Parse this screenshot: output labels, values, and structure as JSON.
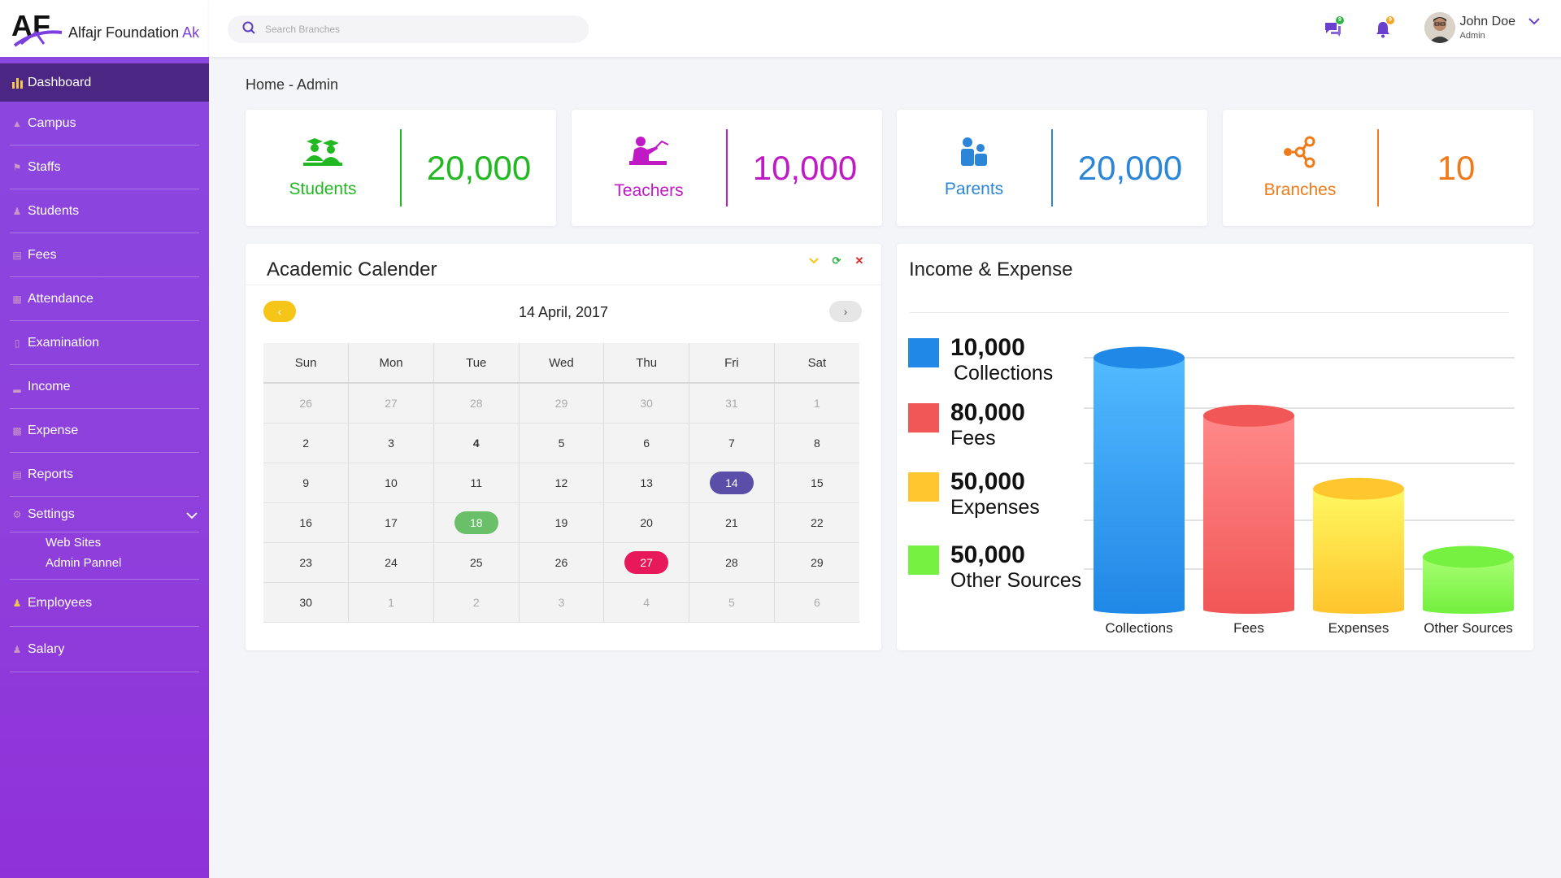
{
  "brand": {
    "logo_text": "AF",
    "name": "Alfajr Foundation",
    "name_accent": "Ak"
  },
  "search": {
    "placeholder": "Search Branches"
  },
  "topbar": {
    "chat_badge": "9",
    "notif_badge": "9"
  },
  "user": {
    "name": "John Doe",
    "role": "Admin"
  },
  "sidebar": {
    "items": [
      {
        "label": "Dashboard",
        "icon": "bar-chart-icon"
      },
      {
        "label": "Campus",
        "icon": "campus-icon"
      },
      {
        "label": "Staffs",
        "icon": "staff-icon"
      },
      {
        "label": "Students",
        "icon": "students-icon"
      },
      {
        "label": "Fees",
        "icon": "fees-icon"
      },
      {
        "label": "Attendance",
        "icon": "attendance-icon"
      },
      {
        "label": "Examination",
        "icon": "examination-icon"
      },
      {
        "label": "Income",
        "icon": "income-icon"
      },
      {
        "label": "Expense",
        "icon": "expense-icon"
      },
      {
        "label": "Reports",
        "icon": "reports-icon"
      },
      {
        "label": "Settings",
        "icon": "settings-icon"
      },
      {
        "label": "Employees",
        "icon": "employees-icon"
      },
      {
        "label": "Salary",
        "icon": "salary-icon"
      }
    ],
    "settings_sub": [
      "Web Sites",
      "Admin Pannel"
    ]
  },
  "breadcrumb": "Home - Admin",
  "stats": [
    {
      "label": "Students",
      "value": "20,000",
      "color": "#22b822",
      "icon": "graduates-icon"
    },
    {
      "label": "Teachers",
      "value": "10,000",
      "color": "#c01ac4",
      "icon": "teacher-icon"
    },
    {
      "label": "Parents",
      "value": "20,000",
      "color": "#2b86d8",
      "icon": "parents-icon"
    },
    {
      "label": "Branches",
      "value": "10",
      "color": "#f07a19",
      "icon": "branches-icon"
    }
  ],
  "calendar": {
    "title": "Academic Calender",
    "date_label": "14 April, 2017",
    "weekdays": [
      "Sun",
      "Mon",
      "Tue",
      "Wed",
      "Thu",
      "Fri",
      "Sat"
    ],
    "weeks": [
      [
        "26",
        "27",
        "28",
        "29",
        "30",
        "31",
        "1"
      ],
      [
        "2",
        "3",
        "4",
        "5",
        "6",
        "7",
        "8"
      ],
      [
        "9",
        "10",
        "11",
        "12",
        "13",
        "14",
        "15"
      ],
      [
        "16",
        "17",
        "18",
        "19",
        "20",
        "21",
        "22"
      ],
      [
        "23",
        "24",
        "25",
        "26",
        "27",
        "28",
        "29"
      ],
      [
        "30",
        "1",
        "2",
        "3",
        "4",
        "5",
        "6"
      ]
    ],
    "highlights": {
      "14": "#5b4ea8",
      "18": "#6abf69",
      "27": "#e8195a"
    }
  },
  "income_expense": {
    "title": "Income & Expense",
    "legend": [
      {
        "value": "10,000",
        "label": "Collections",
        "color": "#2088e6"
      },
      {
        "value": "80,000",
        "label": "Fees",
        "color": "#f25757"
      },
      {
        "value": "50,000",
        "label": "Expenses",
        "color": "#ffc62e"
      },
      {
        "value": "50,000",
        "label": "Other Sources",
        "color": "#76f041"
      }
    ]
  },
  "chart_data": {
    "type": "bar",
    "title": "Income & Expense",
    "categories": [
      "Collections",
      "Fees",
      "Expenses",
      "Other Sources"
    ],
    "values": [
      100,
      77,
      48,
      21
    ],
    "colors": [
      "#2088e6",
      "#f25757",
      "#ffc62e",
      "#76f041"
    ],
    "ylim": [
      0,
      100
    ],
    "grid": true,
    "style": "3d-cylinder"
  }
}
